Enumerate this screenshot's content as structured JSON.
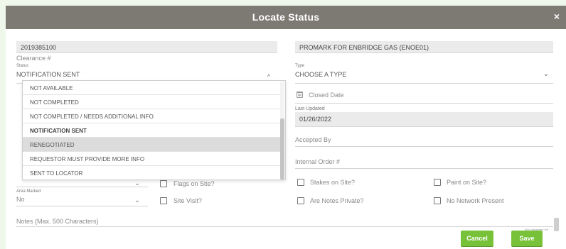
{
  "dialog": {
    "title": "Locate Status",
    "close_glyph": "×"
  },
  "left": {
    "clearance_value": "2019385100",
    "clearance_label": "Clearance #",
    "status_label": "Status",
    "status_value": "NOTIFICATION SENT",
    "status_chevron": "^",
    "area_marked_label": "Area Marked",
    "area_marked_value": "No",
    "area_chevron": "⌄",
    "hidden_chevron": "⌄"
  },
  "status_options": [
    {
      "label": "NOT AVAILABLE",
      "state": "normal"
    },
    {
      "label": "NOT COMPLETED",
      "state": "normal"
    },
    {
      "label": "NOT COMPLETED / NEEDS ADDITIONAL INFO",
      "state": "normal"
    },
    {
      "label": "NOTIFICATION SENT",
      "state": "selected"
    },
    {
      "label": "RENEGOTIATED",
      "state": "hover"
    },
    {
      "label": "REQUESTOR MUST PROVIDE MORE INFO",
      "state": "normal"
    },
    {
      "label": "SENT TO LOCATOR",
      "state": "normal"
    }
  ],
  "right": {
    "company_value": "PROMARK FOR ENBRIDGE GAS (ENOE01)",
    "type_label": "Type",
    "type_value": "CHOOSE A TYPE",
    "type_chevron": "⌄",
    "closed_date_placeholder": "Closed Date",
    "last_updated_label": "Last Updated",
    "last_updated_value": "01/26/2022",
    "accepted_by_placeholder": "Accepted By",
    "internal_order_placeholder": "Internal Order #"
  },
  "checkboxes": {
    "flags_on_site": "Flags on Site?",
    "site_visit": "Site Visit?",
    "stakes_on_site": "Stakes on Site?",
    "paint_on_site": "Paint on Site?",
    "notes_private": "Are Notes Private?",
    "no_network": "No Network Present"
  },
  "notes": {
    "placeholder": "Notes (Max. 500 Characters)",
    "counter": "500 characters left"
  },
  "buttons": {
    "cancel": "Cancel",
    "save": "Save"
  },
  "colors": {
    "header_bg": "#7d7a74",
    "button_green": "#78c23a",
    "page_bg": "#eef7ea"
  }
}
